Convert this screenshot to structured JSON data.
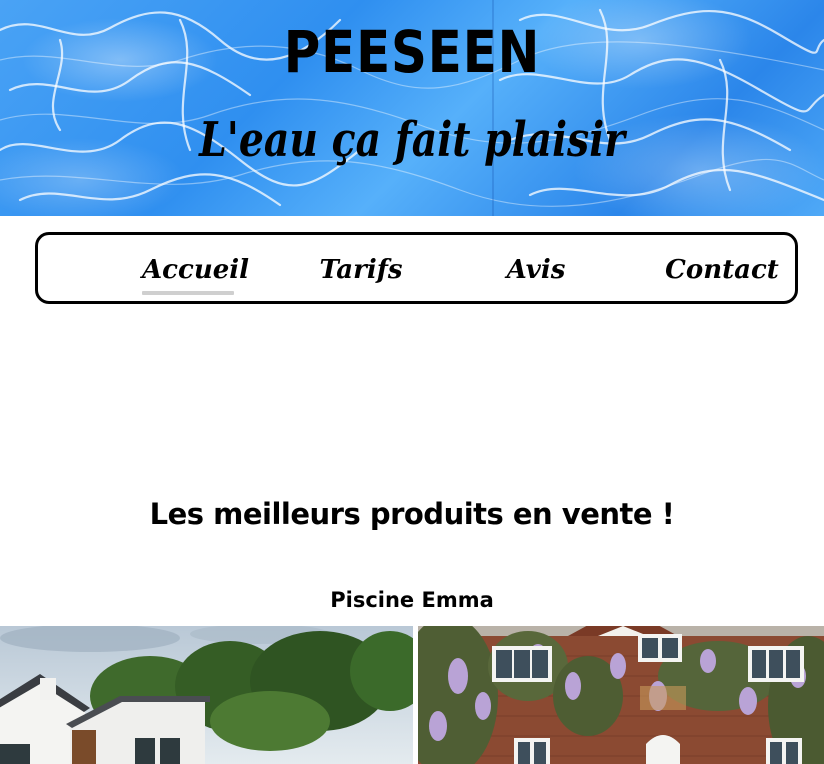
{
  "header": {
    "site_title": "PEESEEN",
    "tagline": "L'eau ça fait plaisir"
  },
  "nav": {
    "items": [
      {
        "label": "Accueil",
        "active": true
      },
      {
        "label": "Tarifs",
        "active": false
      },
      {
        "label": "Avis",
        "active": false
      },
      {
        "label": "Contact",
        "active": false
      }
    ]
  },
  "main": {
    "section_title": "Les meilleurs produits en vente !",
    "product": {
      "name": "Piscine Emma"
    }
  },
  "colors": {
    "water_blue": "#3a98f2",
    "nav_border": "#000000",
    "active_underline": "#cfcfcf"
  }
}
